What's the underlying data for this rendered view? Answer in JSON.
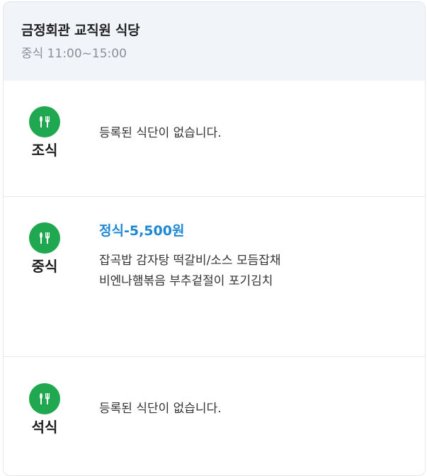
{
  "restaurant": {
    "name": "금정회관 교직원 식당",
    "hours": "중식 11:00~15:00"
  },
  "meals": {
    "breakfast": {
      "label": "조식",
      "icon": "fork-knife-icon",
      "message": "등록된 식단이 없습니다."
    },
    "lunch": {
      "label": "중식",
      "icon": "fork-knife-icon",
      "menu_title": "정식-5,500원",
      "menu_lines": [
        "잡곡밥 감자탕 떡갈비/소스 모듬잡채",
        "비엔나햄볶음 부추겉절이 포기김치"
      ]
    },
    "dinner": {
      "label": "석식",
      "icon": "fork-knife-icon",
      "message": "등록된 식단이 없습니다."
    }
  },
  "colors": {
    "icon_background": "#1fa84f",
    "menu_title": "#1d87d6",
    "header_background": "#f1f4f9"
  }
}
